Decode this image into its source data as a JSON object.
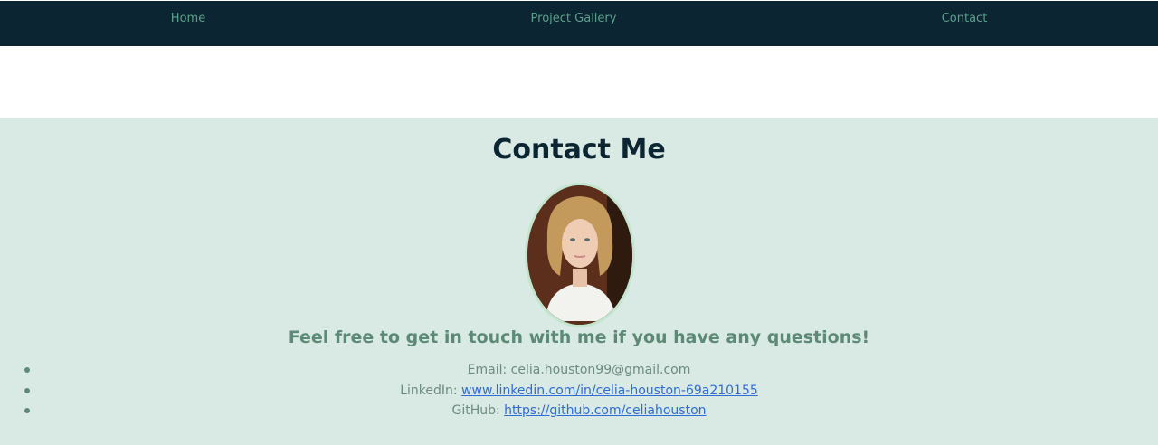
{
  "nav": {
    "items": [
      {
        "label": "Home"
      },
      {
        "label": "Project Gallery"
      },
      {
        "label": "Contact"
      }
    ]
  },
  "contact": {
    "title": "Contact Me",
    "photo_alt": "Profile photo",
    "subtitle": "Feel free to get in touch with me if you have any questions!",
    "items": [
      {
        "label": "Email: ",
        "value": "celia.houston99@gmail.com"
      },
      {
        "label": "LinkedIn: ",
        "value": "www.linkedin.com/in/celia-houston-69a210155"
      },
      {
        "label": "GitHub: ",
        "value": "https://github.com/celiahouston"
      }
    ]
  },
  "colors": {
    "nav_background": "#0b2532",
    "nav_link": "#5aa18c",
    "section_background": "#d9eae4",
    "title": "#0b2532",
    "subtitle": "#5d8a77",
    "link": "#2e6bd6"
  }
}
